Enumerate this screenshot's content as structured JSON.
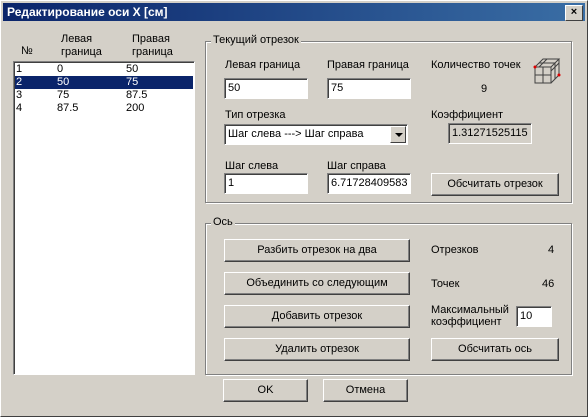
{
  "window": {
    "title": "Редактирование оси X [см]",
    "close": "×"
  },
  "list": {
    "headers": {
      "num": "№",
      "left": "Левая граница",
      "right": "Правая граница"
    },
    "rows": [
      {
        "num": "1",
        "left": "0",
        "right": "50"
      },
      {
        "num": "2",
        "left": "50",
        "right": "75"
      },
      {
        "num": "3",
        "left": "75",
        "right": "87.5"
      },
      {
        "num": "4",
        "left": "87.5",
        "right": "200"
      }
    ],
    "selected_index": 1
  },
  "segment": {
    "group_label": "Текущий отрезок",
    "left_label": "Левая граница",
    "left_value": "50",
    "right_label": "Правая граница",
    "right_value": "75",
    "count_label": "Количество точек",
    "count_value": "9",
    "type_label": "Тип отрезка",
    "type_value": "Шаг слева  ---> Шаг справа",
    "coef_label": "Коэффициент",
    "coef_value": "1.31271525115",
    "step_left_label": "Шаг слева",
    "step_left_value": "1",
    "step_right_label": "Шаг справа",
    "step_right_value": "6.71728409583",
    "calc_button": "Обсчитать отрезок"
  },
  "axis": {
    "group_label": "Ось",
    "split_button": "Разбить отрезок на два",
    "merge_button": "Объединить со следующим",
    "add_button": "Добавить отрезок",
    "delete_button": "Удалить отрезок",
    "segments_label": "Отрезков",
    "segments_value": "4",
    "points_label": "Точек",
    "points_value": "46",
    "maxcoef_label": "Максимальный коэффициент",
    "maxcoef_value": "10",
    "calc_axis_button": "Обсчитать ось"
  },
  "footer": {
    "ok": "OK",
    "cancel": "Отмена"
  }
}
